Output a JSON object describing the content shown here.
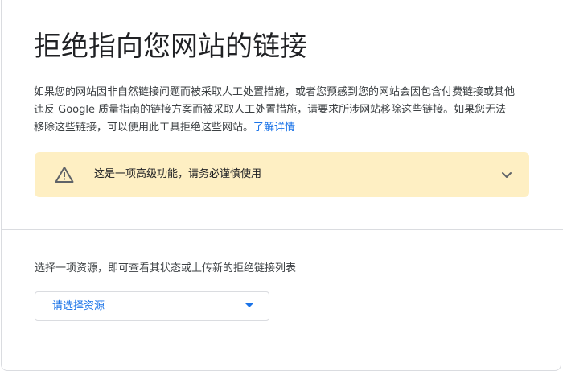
{
  "header": {
    "title": "拒绝指向您网站的链接"
  },
  "description": {
    "text": "如果您的网站因非自然链接问题而被采取人工处置措施，或者您预感到您的网站会因包含付费链接或其他违反 Google 质量指南的链接方案而被采取人工处置措施，请要求所涉网站移除这些链接。如果您无法移除这些链接，可以使用此工具拒绝这些网站。",
    "link_label": "了解详情"
  },
  "warning": {
    "icon": "warning-icon",
    "text": "这是一项高级功能，请务必谨慎使用",
    "background_color": "#feefc3"
  },
  "property_select": {
    "label": "选择一项资源，即可查看其状态或上传新的拒绝链接列表",
    "value": "请选择资源",
    "accent_color": "#1a73e8"
  }
}
